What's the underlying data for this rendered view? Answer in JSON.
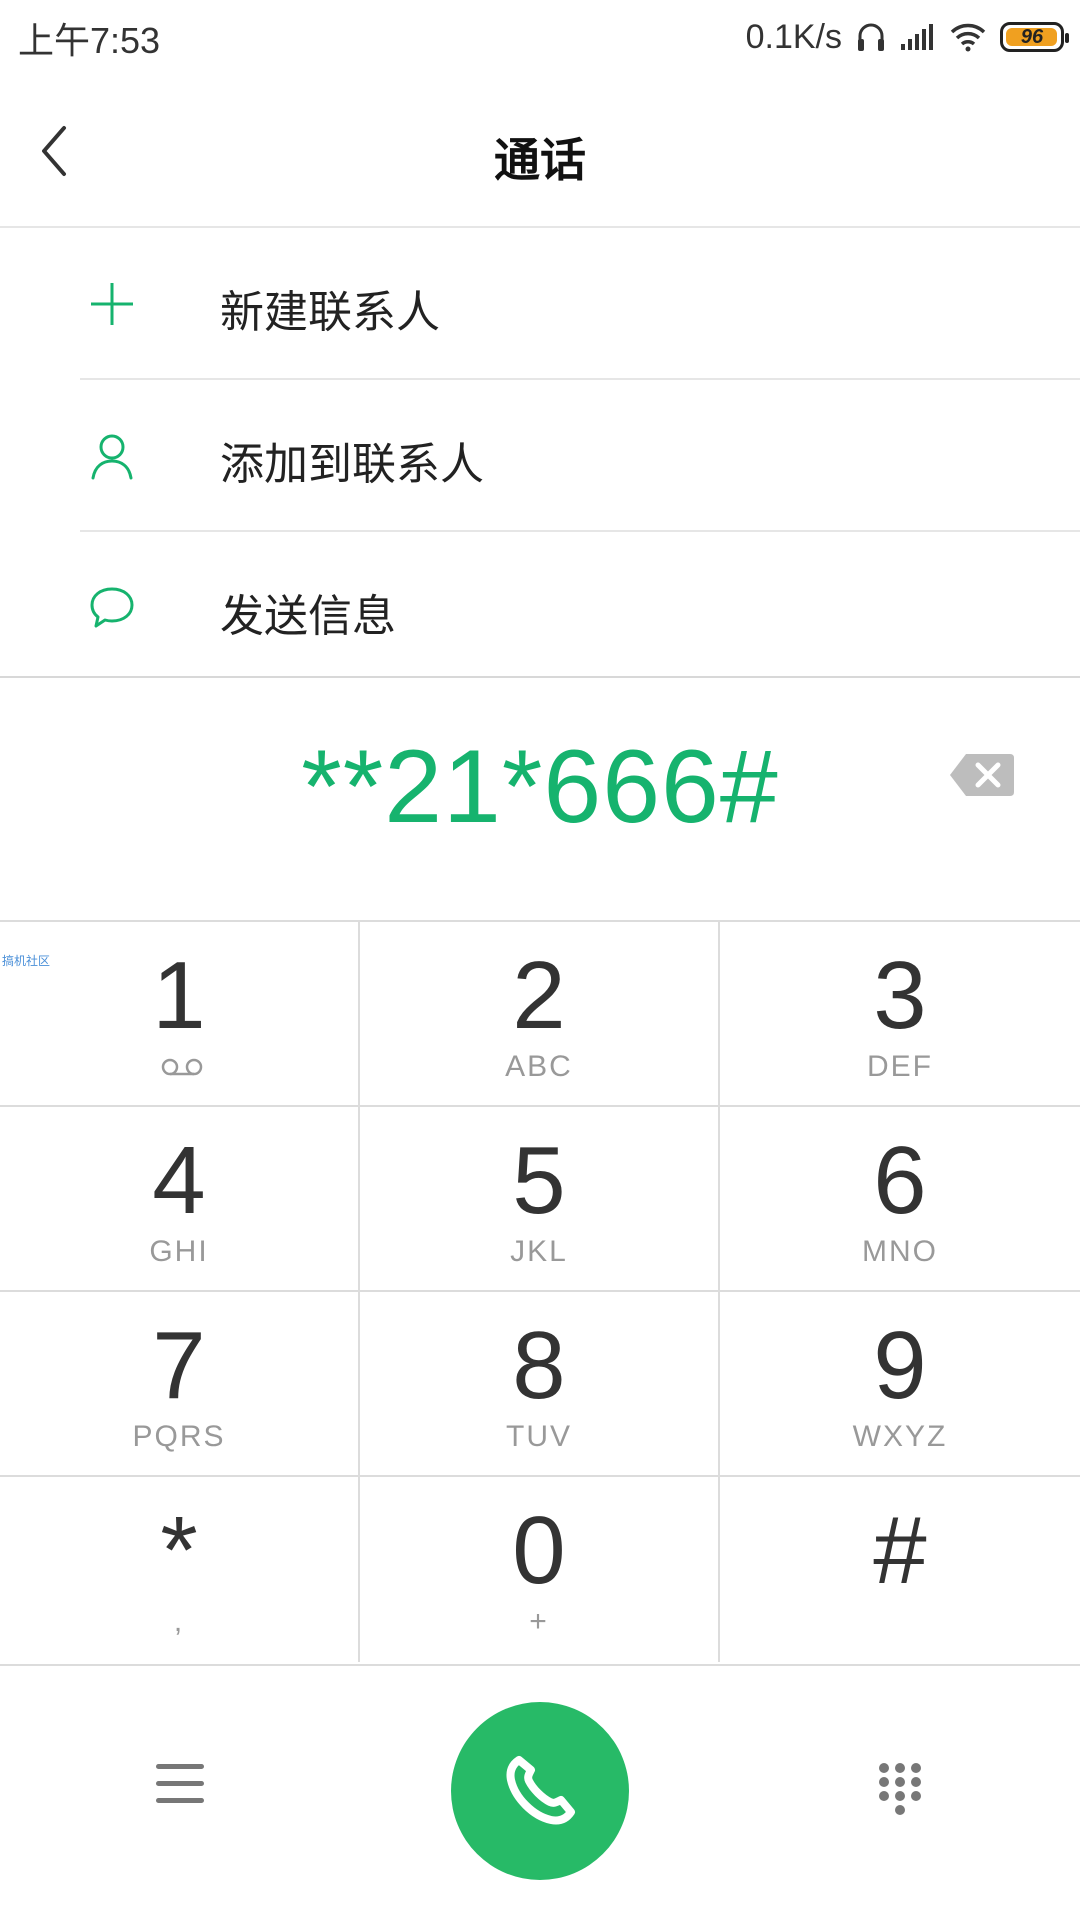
{
  "status_bar": {
    "time": "上午7:53",
    "net_speed": "0.1K/s",
    "battery_level": "96",
    "icons": [
      "headphone-icon",
      "signal-icon",
      "wifi-icon",
      "battery-icon"
    ]
  },
  "header": {
    "title": "通话",
    "back_icon": "back-arrow-icon"
  },
  "actions": [
    {
      "label": "新建联系人",
      "icon": "plus-icon"
    },
    {
      "label": "添加到联系人",
      "icon": "person-icon"
    },
    {
      "label": "发送信息",
      "icon": "chat-bubble-icon"
    }
  ],
  "dialer": {
    "number": "**21*666#",
    "backspace_icon": "backspace-icon"
  },
  "keypad": {
    "watermark": "搞机社区",
    "keys": [
      {
        "digit": "1",
        "sub": ""
      },
      {
        "digit": "2",
        "sub": "ABC"
      },
      {
        "digit": "3",
        "sub": "DEF"
      },
      {
        "digit": "4",
        "sub": "GHI"
      },
      {
        "digit": "5",
        "sub": "JKL"
      },
      {
        "digit": "6",
        "sub": "MNO"
      },
      {
        "digit": "7",
        "sub": "PQRS"
      },
      {
        "digit": "8",
        "sub": "TUV"
      },
      {
        "digit": "9",
        "sub": "WXYZ"
      },
      {
        "digit": "*",
        "sub": ","
      },
      {
        "digit": "0",
        "sub": "+"
      },
      {
        "digit": "#",
        "sub": ""
      }
    ]
  },
  "bottom_bar": {
    "menu_icon": "menu-icon",
    "call_icon": "phone-icon",
    "dialpad_icon": "dialpad-icon",
    "call_color": "#27ba67"
  },
  "colors": {
    "accent": "#16b36e",
    "divider": "#e6e6e6"
  }
}
